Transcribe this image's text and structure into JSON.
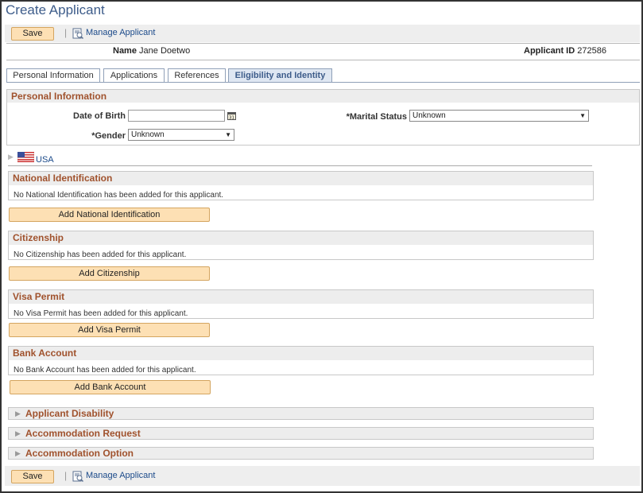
{
  "page": {
    "title": "Create Applicant"
  },
  "toolbar": {
    "save_label": "Save",
    "separator": "|",
    "manage_label": "Manage Applicant"
  },
  "header": {
    "name_label": "Name",
    "name_value": "Jane Doetwo",
    "applicant_id_label": "Applicant ID",
    "applicant_id_value": "272586"
  },
  "tabs": [
    {
      "label": "Personal Information"
    },
    {
      "label": "Applications"
    },
    {
      "label": "References"
    },
    {
      "label": "Eligibility and Identity",
      "active": true
    }
  ],
  "personal_info": {
    "heading": "Personal Information",
    "dob_label": "Date of Birth",
    "dob_value": "",
    "gender_label": "*Gender",
    "gender_value": "Unknown",
    "marital_label": "*Marital Status",
    "marital_value": "Unknown"
  },
  "country": {
    "label": "USA"
  },
  "sections": [
    {
      "heading": "National Identification",
      "message": "No National Identification has been added for this applicant.",
      "button": "Add National Identification"
    },
    {
      "heading": "Citizenship",
      "message": "No Citizenship has been added for this applicant.",
      "button": "Add Citizenship"
    },
    {
      "heading": "Visa Permit",
      "message": "No Visa Permit has been added for this applicant.",
      "button": "Add Visa Permit"
    },
    {
      "heading": "Bank Account",
      "message": "No Bank Account has been added for this applicant.",
      "button": "Add Bank Account"
    }
  ],
  "collapsibles": [
    {
      "label": "Applicant Disability"
    },
    {
      "label": "Accommodation Request"
    },
    {
      "label": "Accommodation Option"
    }
  ],
  "icons": {
    "calendar": "calendar-icon",
    "manage": "manage-applicant-icon",
    "flag": "us-flag-icon",
    "chevron": "chevron-down-icon",
    "expand": "expand-triangle-icon"
  },
  "colors": {
    "accent_heading": "#a0522d",
    "button_bg": "#fde0b4",
    "link": "#1b4a8a",
    "title": "#3d5c8a"
  }
}
